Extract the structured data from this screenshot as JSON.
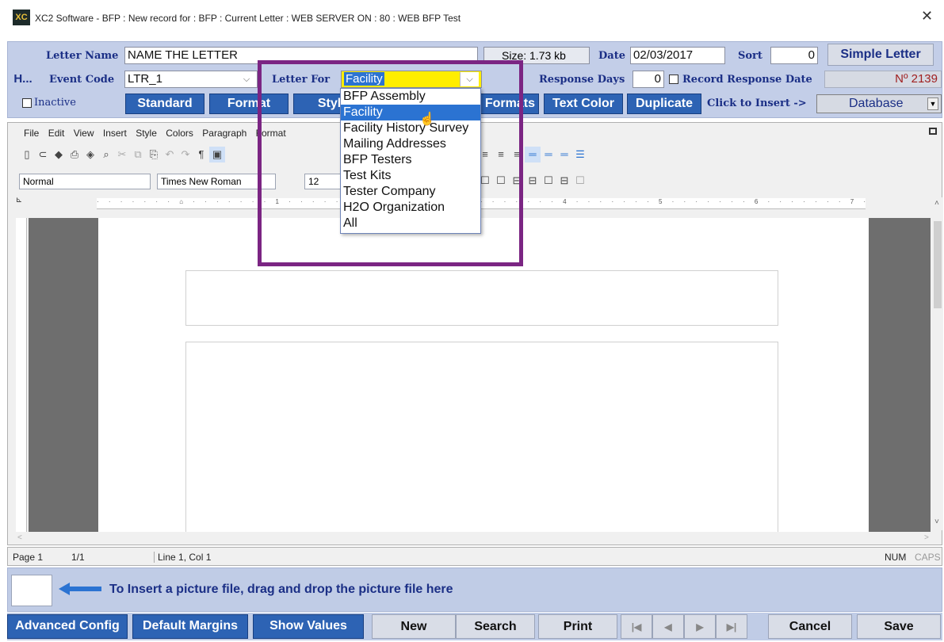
{
  "window": {
    "title": "XC2 Software - BFP : New record for : BFP : Current Letter : WEB SERVER ON : 80 : WEB BFP Test",
    "app_icon_text": "XC"
  },
  "header": {
    "letter_name_label": "Letter Name",
    "letter_name_value": "NAME THE LETTER",
    "size_label": "Size:",
    "size_value": "1.73 kb",
    "date_label": "Date",
    "date_value": "02/03/2017",
    "sort_label": "Sort",
    "sort_value": "0",
    "simple_letter_button": "Simple Letter",
    "h_button": "H...",
    "event_code_label": "Event Code",
    "event_code_value": "LTR_1",
    "letter_for_label": "Letter For",
    "letter_for_value": "Facility",
    "response_days_label": "Response Days",
    "response_days_value": "0",
    "record_response_label": "Record Response Date",
    "record_number": "Nº 2139",
    "inactive_label": "Inactive",
    "buttons": [
      "Standard",
      "Format",
      "Style",
      "Formats",
      "Text Color",
      "Duplicate"
    ],
    "click_to_insert_label": "Click to Insert ->",
    "insert_value": "Database"
  },
  "dropdown": {
    "options": [
      "BFP Assembly",
      "Facility",
      "Facility History Survey",
      "Mailing Addresses",
      "BFP Testers",
      "Test Kits",
      "Tester Company",
      "H2O Organization",
      "All"
    ],
    "selected": "Facility"
  },
  "editor": {
    "menu": [
      "File",
      "Edit",
      "View",
      "Insert",
      "Style",
      "Colors",
      "Paragraph",
      "Format"
    ],
    "style_value": "Normal",
    "font_value": "Times New Roman",
    "size_value": "12"
  },
  "status": {
    "page": "Page 1",
    "pages": "1/1",
    "position": "Line 1, Col 1",
    "num": "NUM",
    "caps": "CAPS"
  },
  "picture_hint": "To Insert a picture file, drag and drop the picture file here",
  "bottom": {
    "advanced_config": "Advanced Config",
    "default_margins": "Default Margins",
    "show_values": "Show Values",
    "new": "New",
    "search": "Search",
    "print": "Print",
    "cancel": "Cancel",
    "save": "Save"
  },
  "colors": {
    "accent": "#2d63b4",
    "highlight": "#7b2583",
    "letter_for_bg": "#ffee00"
  }
}
